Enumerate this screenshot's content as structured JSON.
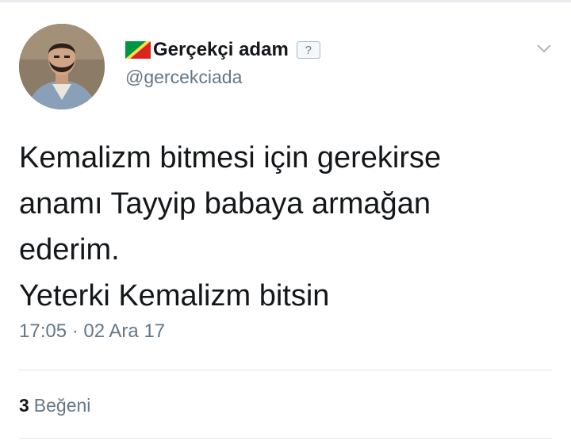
{
  "tweet": {
    "author": {
      "display_name": "Gerçekçi adam",
      "handle": "@gercekciada",
      "badge_text": "?"
    },
    "text_lines": [
      "Kemalizm bitmesi için gerekirse",
      "anamı Tayyip babaya armağan",
      "ederim.",
      "Yeterki Kemalizm bitsin"
    ],
    "timestamp": "17:05 · 02 Ara 17",
    "likes": {
      "count": "3",
      "label": "Beğeni"
    }
  },
  "icons": {
    "flag": "flag-icon",
    "badge": "unknown-emoji-icon",
    "menu": "chevron-down-icon"
  },
  "colors": {
    "text_primary": "#14171a",
    "text_secondary": "#657786",
    "divider": "#e1e8ed"
  }
}
